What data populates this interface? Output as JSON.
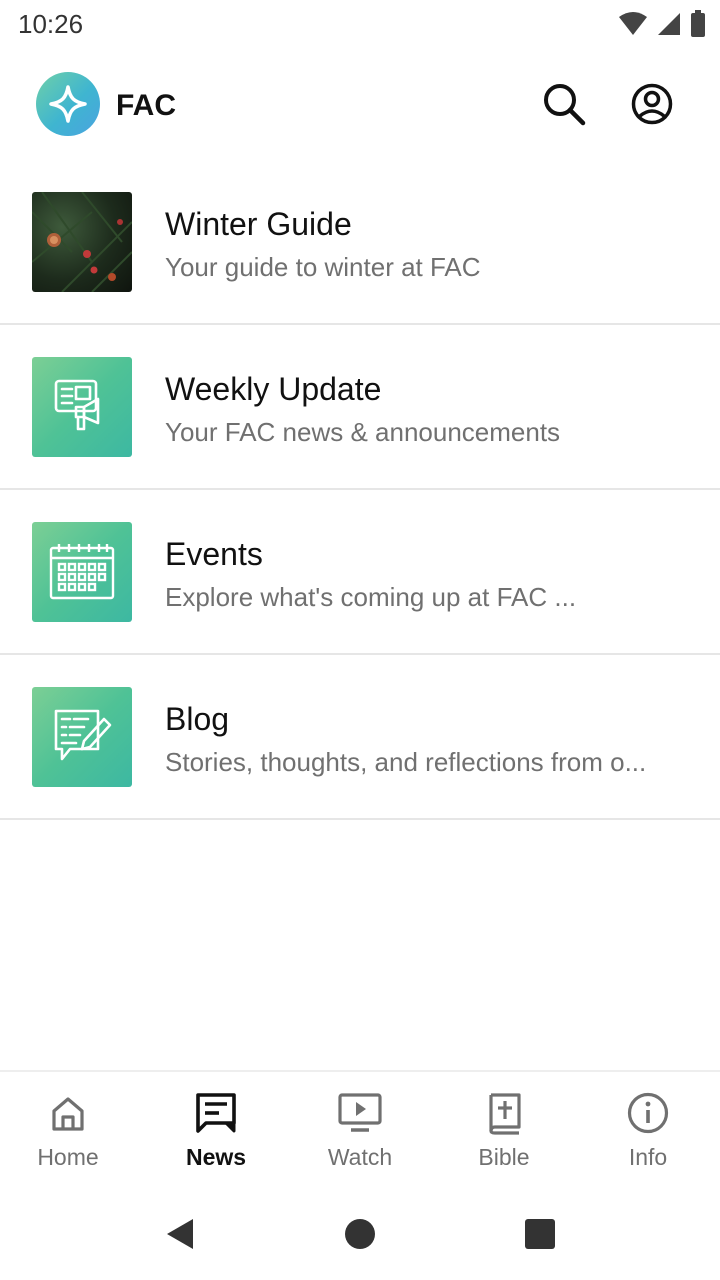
{
  "status_bar": {
    "time": "10:26",
    "icons": [
      "wifi-icon",
      "signal-icon",
      "battery-icon"
    ]
  },
  "header": {
    "app_name": "FAC",
    "logo_icon": "sparkle-icon",
    "actions": [
      "search-icon",
      "profile-icon"
    ]
  },
  "feed": {
    "items": [
      {
        "title": "Winter Guide",
        "subtitle": "Your guide to winter at FAC",
        "thumb": "photo"
      },
      {
        "title": "Weekly Update",
        "subtitle": "Your FAC news & announcements",
        "thumb": "megaphone-icon"
      },
      {
        "title": "Events",
        "subtitle": "Explore what's coming up at FAC ...",
        "thumb": "calendar-icon"
      },
      {
        "title": "Blog",
        "subtitle": "Stories, thoughts, and reflections from o...",
        "thumb": "note-pencil-icon"
      }
    ]
  },
  "bottom_nav": {
    "tabs": [
      {
        "label": "Home",
        "icon": "home-icon"
      },
      {
        "label": "News",
        "icon": "news-icon",
        "active": true
      },
      {
        "label": "Watch",
        "icon": "tv-play-icon"
      },
      {
        "label": "Bible",
        "icon": "bible-icon"
      },
      {
        "label": "Info",
        "icon": "info-icon"
      }
    ]
  },
  "colors": {
    "accent_green": "#4fc296",
    "text_primary": "#111111",
    "text_secondary": "#707070"
  }
}
